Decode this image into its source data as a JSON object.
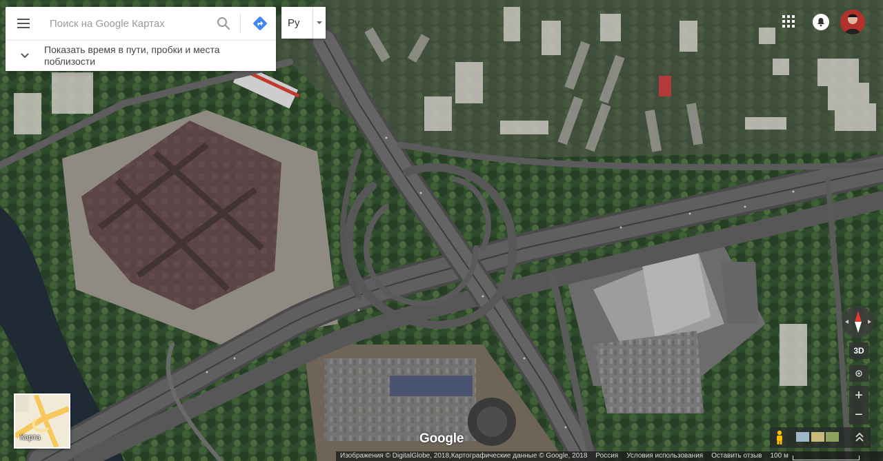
{
  "search": {
    "placeholder": "Поиск на Google Картах",
    "travel_info": "Показать время в пути, пробки и места поблизости"
  },
  "language": {
    "label": "Ру"
  },
  "map_type": {
    "label": "Карта"
  },
  "controls": {
    "three_d_label": "3D",
    "zoom_in_label": "+",
    "zoom_out_label": "−"
  },
  "branding": {
    "logo_text": "Google"
  },
  "footer": {
    "imagery": "Изображения © DigitalGlobe, 2018,Картографические данные © Google, 2018",
    "country": "Россия",
    "terms": "Условия использования",
    "feedback": "Оставить отзыв",
    "scale": "100 м"
  },
  "colors": {
    "accent_blue": "#4285f4",
    "compass_red": "#e53935"
  },
  "icons": [
    "menu-icon",
    "search-icon",
    "directions-icon",
    "chevron-down-icon",
    "dropdown-arrow-icon",
    "apps-icon",
    "notifications-icon",
    "compass-icon",
    "locate-icon",
    "pegman-icon",
    "expand-icon"
  ]
}
